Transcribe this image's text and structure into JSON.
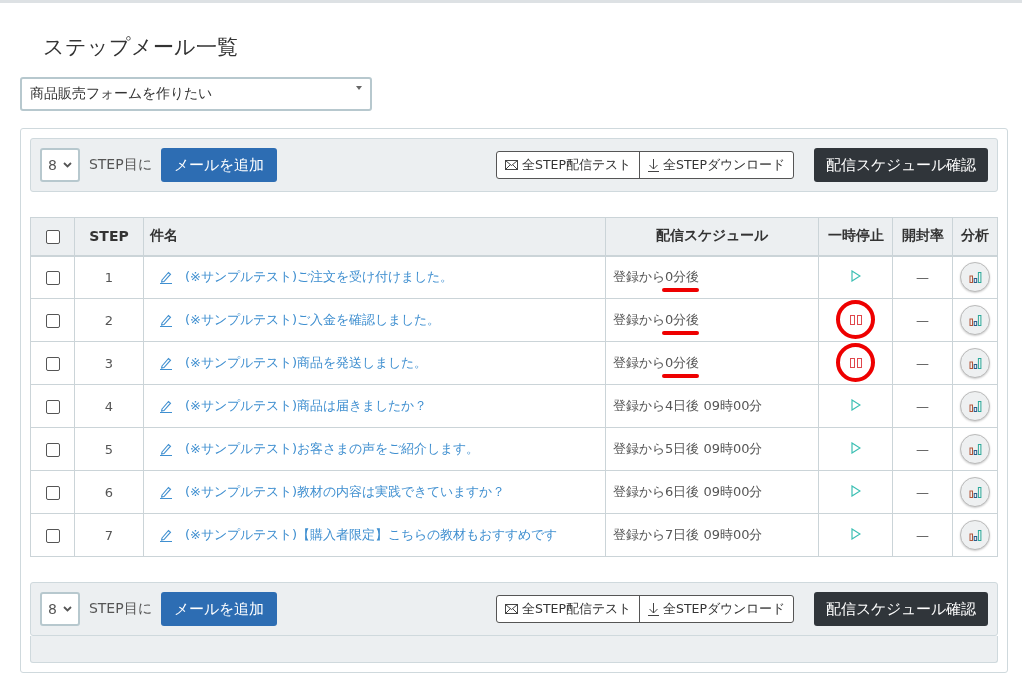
{
  "page_title": "ステップメール一覧",
  "form_select": {
    "value": "商品販売フォームを作りたい"
  },
  "toolbars": [
    {
      "step_value": "8",
      "step_label": "STEP目に",
      "add_button": "メールを追加",
      "test_button": "全STEP配信テスト",
      "download_button": "全STEPダウンロード",
      "schedule_button": "配信スケジュール確認"
    },
    {
      "step_value": "8",
      "step_label": "STEP目に",
      "add_button": "メールを追加",
      "test_button": "全STEP配信テスト",
      "download_button": "全STEPダウンロード",
      "schedule_button": "配信スケジュール確認"
    }
  ],
  "table": {
    "select_all_checked": false,
    "columns": [
      "STEP",
      "件名",
      "配信スケジュール",
      "一時停止",
      "開封率",
      "分析"
    ],
    "rows": [
      {
        "checked": false,
        "step": "1",
        "subject": "(※サンプルテスト)ご注文を受け付けました。",
        "schedule": "登録から0分後",
        "schedule_marked": true,
        "paused": false,
        "pause_marked": false,
        "open_rate": "—"
      },
      {
        "checked": false,
        "step": "2",
        "subject": "(※サンプルテスト)ご入金を確認しました。",
        "schedule": "登録から0分後",
        "schedule_marked": true,
        "paused": true,
        "pause_marked": true,
        "open_rate": "—"
      },
      {
        "checked": false,
        "step": "3",
        "subject": "(※サンプルテスト)商品を発送しました。",
        "schedule": "登録から0分後",
        "schedule_marked": true,
        "paused": true,
        "pause_marked": true,
        "open_rate": "—"
      },
      {
        "checked": false,
        "step": "4",
        "subject": "(※サンプルテスト)商品は届きましたか？",
        "schedule": "登録から4日後 09時00分",
        "schedule_marked": false,
        "paused": false,
        "pause_marked": false,
        "open_rate": "—"
      },
      {
        "checked": false,
        "step": "5",
        "subject": "(※サンプルテスト)お客さまの声をご紹介します。",
        "schedule": "登録から5日後 09時00分",
        "schedule_marked": false,
        "paused": false,
        "pause_marked": false,
        "open_rate": "—"
      },
      {
        "checked": false,
        "step": "6",
        "subject": "(※サンプルテスト)教材の内容は実践できていますか？",
        "schedule": "登録から6日後 09時00分",
        "schedule_marked": false,
        "paused": false,
        "pause_marked": false,
        "open_rate": "—"
      },
      {
        "checked": false,
        "step": "7",
        "subject": "(※サンプルテスト)【購入者限定】こちらの教材もおすすめです",
        "schedule": "登録から7日後 09時00分",
        "schedule_marked": false,
        "paused": false,
        "pause_marked": false,
        "open_rate": "—"
      }
    ]
  }
}
